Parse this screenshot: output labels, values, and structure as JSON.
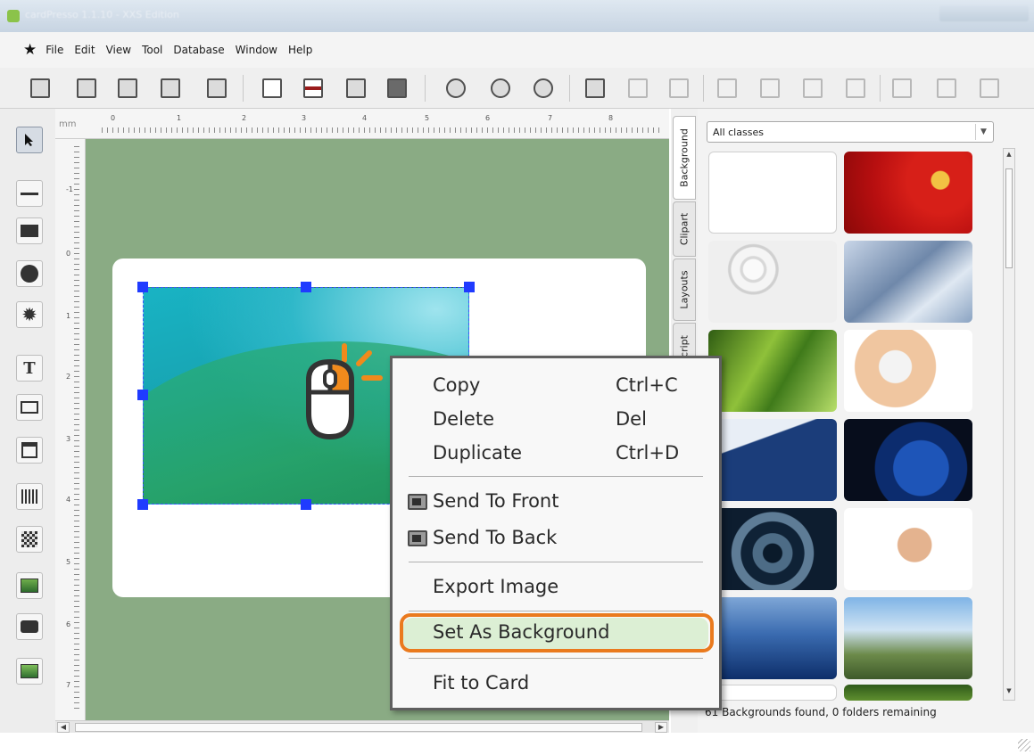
{
  "window": {
    "title": "cardPresso 1.1.10 - XXS Edition"
  },
  "menu": {
    "items": [
      {
        "id": "file",
        "label": "File"
      },
      {
        "id": "edit",
        "label": "Edit"
      },
      {
        "id": "view",
        "label": "View"
      },
      {
        "id": "tool",
        "label": "Tool"
      },
      {
        "id": "database",
        "label": "Database"
      },
      {
        "id": "window",
        "label": "Window"
      },
      {
        "id": "help",
        "label": "Help"
      }
    ]
  },
  "ruler": {
    "unit": "mm",
    "top_labels": [
      "0",
      "1",
      "2",
      "3",
      "4",
      "5",
      "6",
      "7",
      "8"
    ],
    "left_labels": [
      "-1",
      "0",
      "1",
      "2",
      "3",
      "4",
      "5",
      "6",
      "7"
    ]
  },
  "side_tabs": [
    "Background",
    "Clipart",
    "Layouts",
    "Script"
  ],
  "panel": {
    "filter_value": "All classes",
    "status": "61 Backgrounds found, 0 folders remaining"
  },
  "context_menu": {
    "items": [
      {
        "label": "Copy",
        "shortcut": "Ctrl+C"
      },
      {
        "label": "Delete",
        "shortcut": "Del"
      },
      {
        "label": "Duplicate",
        "shortcut": "Ctrl+D"
      },
      {
        "label": "Send To Front",
        "shortcut": ""
      },
      {
        "label": "Send To Back",
        "shortcut": ""
      },
      {
        "label": "Export Image",
        "shortcut": ""
      },
      {
        "label": "Set As Background",
        "shortcut": ""
      },
      {
        "label": "Fit to Card",
        "shortcut": ""
      }
    ],
    "highlighted": "Set As Background"
  },
  "colors": {
    "canvas": "#8aab84",
    "selection_handle": "#1f3bff",
    "highlight_ring": "#ea7a1e",
    "highlight_fill": "#dcefd4"
  },
  "icons": {
    "toolbar": [
      "new-card-icon",
      "open-icon",
      "save-icon",
      "save-as-icon",
      "print-icon",
      "card-front-icon",
      "card-back-icon",
      "print-preview-icon",
      "encode-icon",
      "zoom-in-icon",
      "zoom-out-icon",
      "zoom-fit-icon",
      "import-icon",
      "export-icon",
      "record-icon",
      "first-record-icon",
      "prev-record-icon",
      "next-record-icon",
      "last-record-icon",
      "refresh-icon",
      "add-record-icon",
      "delete-record-icon"
    ],
    "tools": [
      "select-tool-icon",
      "line-tool-icon",
      "rectangle-tool-icon",
      "ellipse-tool-icon",
      "star-tool-icon",
      "text-tool-icon",
      "field-tool-icon",
      "calendar-tool-icon",
      "barcode-tool-icon",
      "qrcode-tool-icon",
      "picture-tool-icon",
      "camera-tool-icon",
      "image-tool-icon"
    ],
    "pointer": "mouse-click-icon"
  }
}
